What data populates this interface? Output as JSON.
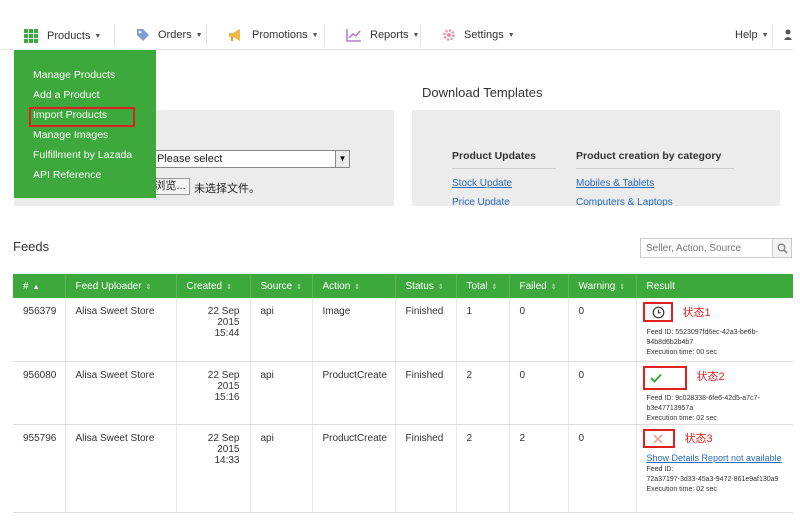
{
  "nav": {
    "products": "Products",
    "orders": "Orders",
    "promotions": "Promotions",
    "reports": "Reports",
    "settings": "Settings",
    "help": "Help"
  },
  "products_menu": {
    "items": [
      "Manage Products",
      "Add a Product",
      "Import Products",
      "Manage Images",
      "Fulfillment by Lazada",
      "API Reference"
    ]
  },
  "upload": {
    "select_value": "Please select",
    "browse_label": "浏览...",
    "file_status": "未选择文件。"
  },
  "download": {
    "title": "Download Templates",
    "col1_title": "Product Updates",
    "col1_links": [
      "Stock Update",
      "Price Update"
    ],
    "col2_title": "Product creation by category",
    "col2_links": [
      "Mobiles & Tablets",
      "Computers & Laptops"
    ]
  },
  "feeds": {
    "title": "Feeds",
    "search_placeholder": "Seller, Action, Source",
    "columns": [
      "#",
      "Feed Uploader",
      "Created",
      "Source",
      "Action",
      "Status",
      "Total",
      "Failed",
      "Warning",
      "Result"
    ],
    "rows": [
      {
        "id": "956379",
        "uploader": "Alisa Sweet Store",
        "created_date": "22 Sep 2015",
        "created_time": "15:44",
        "source": "api",
        "action": "Image",
        "status": "Finished",
        "total": "1",
        "failed": "0",
        "warning": "0",
        "result_label": "状态1",
        "feed_id": "Feed ID: 5523097fd6ec-42a3-be6b-94b8d6b2b4b7",
        "exec_time": "Execution time: 00 sec"
      },
      {
        "id": "956080",
        "uploader": "Alisa Sweet Store",
        "created_date": "22 Sep 2015",
        "created_time": "15:16",
        "source": "api",
        "action": "ProductCreate",
        "status": "Finished",
        "total": "2",
        "failed": "0",
        "warning": "0",
        "result_label": "状态2",
        "feed_id": "Feed ID: 9c028338-6fe6-42d5-a7c7-b3e47713957a",
        "exec_time": "Execution time: 02 sec"
      },
      {
        "id": "955796",
        "uploader": "Alisa Sweet Store",
        "created_date": "22 Sep 2015",
        "created_time": "14:33",
        "source": "api",
        "action": "ProductCreate",
        "status": "Finished",
        "total": "2",
        "failed": "2",
        "warning": "0",
        "result_label": "状态3",
        "details_link": "Show Details Report not available",
        "feed_id_label": "Feed ID:",
        "feed_id": "72a37197-3d33-45a3-9472-861e9af130a9",
        "exec_time": "Execution time: 02 sec"
      }
    ]
  },
  "colors": {
    "brand_green": "#3da83b",
    "highlight_red": "#e02020",
    "link_blue": "#2a6ab8"
  },
  "icons": [
    "grid-icon",
    "tag-icon",
    "megaphone-icon",
    "chart-icon",
    "gear-icon",
    "user-icon",
    "search-icon",
    "clock-icon",
    "check-icon",
    "cross-icon"
  ]
}
